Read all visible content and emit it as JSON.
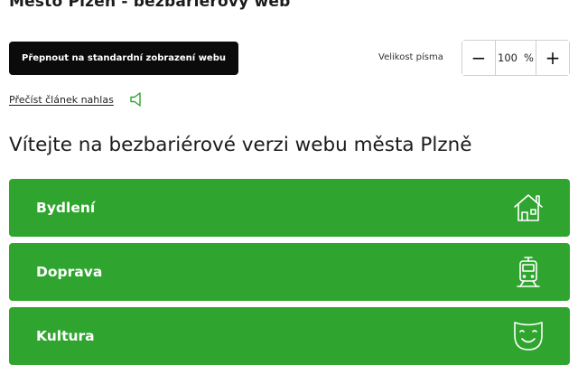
{
  "site": {
    "title": "Město Plzeň - bezbariérový web"
  },
  "toolbar": {
    "switch_label": "Přepnout na standardní zobrazení webu",
    "font_size_label": "Velikost písma",
    "font_size_value": "100",
    "font_size_unit": "%",
    "decrease_symbol": "−",
    "increase_symbol": "+"
  },
  "read_aloud": {
    "label": "Přečíst článek nahlas",
    "icon": "speaker-icon"
  },
  "welcome": {
    "heading": "Vítejte na bezbariérové verzi webu města Plzně"
  },
  "tiles": [
    {
      "label": "Bydlení",
      "icon": "house-icon"
    },
    {
      "label": "Doprava",
      "icon": "tram-icon"
    },
    {
      "label": "Kultura",
      "icon": "theater-mask-icon"
    }
  ],
  "colors": {
    "accent_green": "#2fa52f",
    "button_black": "#0b0b0b",
    "text": "#1b1b1b"
  }
}
